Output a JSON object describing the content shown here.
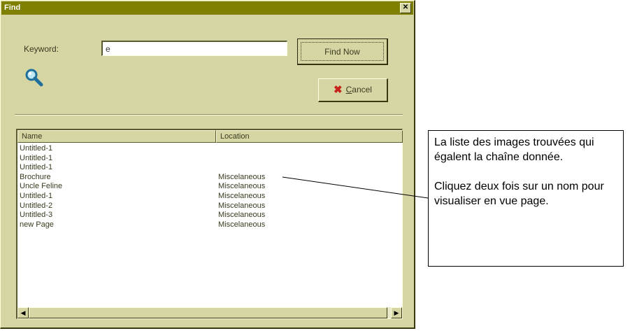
{
  "window": {
    "title": "Find",
    "close_glyph": "✕"
  },
  "search": {
    "keyword_label": "Keyword:",
    "keyword_value": "e"
  },
  "buttons": {
    "find_now": "Find Now",
    "cancel_accel": "C",
    "cancel_rest": "ancel"
  },
  "icons": {
    "search": "magnifier-icon",
    "cancel": "red-x-icon"
  },
  "list": {
    "columns": [
      "Name",
      "Location"
    ],
    "rows": [
      {
        "name": "Untitled-1",
        "location": ""
      },
      {
        "name": "Untitled-1",
        "location": ""
      },
      {
        "name": "Untitled-1",
        "location": ""
      },
      {
        "name": "Brochure",
        "location": "Miscelaneous"
      },
      {
        "name": "Uncle Feline",
        "location": "Miscelaneous"
      },
      {
        "name": "Untitled-1",
        "location": "Miscelaneous"
      },
      {
        "name": "Untitled-2",
        "location": "Miscelaneous"
      },
      {
        "name": "Untitled-3",
        "location": "Miscelaneous"
      },
      {
        "name": "new Page",
        "location": "Miscelaneous"
      }
    ],
    "scroll_left": "◀",
    "scroll_right": "▶"
  },
  "callout": {
    "paragraph1": "La liste des images trouvées qui égalent la chaîne donnée.",
    "paragraph2": "Cliquez deux fois sur un nom pour visualiser en vue page."
  },
  "colors": {
    "titlebar": "#808000",
    "dialog_bg": "#d6d6a4",
    "cancel_x": "#c8201a"
  }
}
